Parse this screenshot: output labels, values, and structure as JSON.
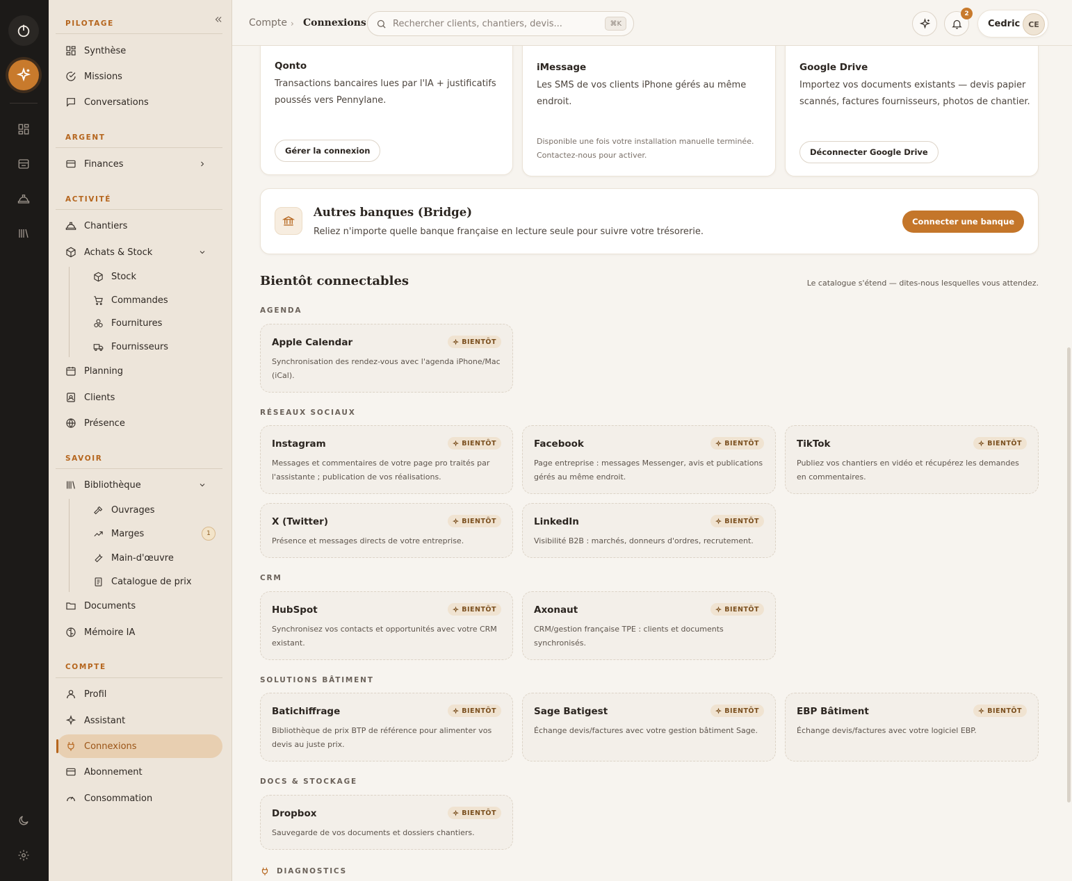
{
  "sidebar": {
    "sections": {
      "pilotage": "PILOTAGE",
      "argent": "ARGENT",
      "activite": "ACTIVITÉ",
      "savoir": "SAVOIR",
      "compte": "COMPTE"
    },
    "items": {
      "synthese": "Synthèse",
      "missions": "Missions",
      "conversations": "Conversations",
      "finances": "Finances",
      "chantiers": "Chantiers",
      "achats_stock": "Achats & Stock",
      "stock": "Stock",
      "commandes": "Commandes",
      "fournitures": "Fournitures",
      "fournisseurs": "Fournisseurs",
      "planning": "Planning",
      "clients": "Clients",
      "presence": "Présence",
      "bibliotheque": "Bibliothèque",
      "ouvrages": "Ouvrages",
      "marges": "Marges",
      "marges_count": "1",
      "main_oeuvre": "Main-d'œuvre",
      "catalogue_prix": "Catalogue de prix",
      "documents": "Documents",
      "memoire_ia": "Mémoire IA",
      "profil": "Profil",
      "assistant": "Assistant",
      "connexions": "Connexions",
      "abonnement": "Abonnement",
      "consommation": "Consommation"
    }
  },
  "topbar": {
    "breadcrumb_root": "Compte",
    "breadcrumb_current": "Connexions",
    "search_placeholder": "Rechercher clients, chantiers, devis...",
    "search_shortcut": "⌘K",
    "notifications_count": "2",
    "user_name": "Cedric",
    "user_initials": "CE"
  },
  "connected": {
    "qonto": {
      "title": "Qonto",
      "desc": "Transactions bancaires lues par l'IA + justificatifs poussés vers Pennylane.",
      "action": "Gérer la connexion"
    },
    "imessage": {
      "title": "iMessage",
      "desc": "Les SMS de vos clients iPhone gérés au même endroit.",
      "note": "Disponible une fois votre installation manuelle terminée. Contactez-nous pour activer."
    },
    "gdrive": {
      "title": "Google Drive",
      "desc": "Importez vos documents existants — devis papier scannés, factures fournisseurs, photos de chantier.",
      "action": "Déconnecter Google Drive"
    }
  },
  "bridge": {
    "title": "Autres banques (Bridge)",
    "desc": "Reliez n'importe quelle banque française en lecture seule pour suivre votre trésorerie.",
    "action": "Connecter une banque"
  },
  "upcoming": {
    "title": "Bientôt connectables",
    "note": "Le catalogue s'étend — dites-nous lesquelles vous attendez.",
    "badge": "BIENTÔT",
    "categories": {
      "agenda": "AGENDA",
      "social": "RÉSEAUX SOCIAUX",
      "crm": "CRM",
      "batiment": "SOLUTIONS BÂTIMENT",
      "docs": "DOCS & STOCKAGE",
      "diagnostics": "DIAGNOSTICS"
    },
    "items": {
      "apple_calendar": {
        "title": "Apple Calendar",
        "desc": "Synchronisation des rendez-vous avec l'agenda iPhone/Mac (iCal)."
      },
      "instagram": {
        "title": "Instagram",
        "desc": "Messages et commentaires de votre page pro traités par l'assistante ; publication de vos réalisations."
      },
      "facebook": {
        "title": "Facebook",
        "desc": "Page entreprise : messages Messenger, avis et publications gérés au même endroit."
      },
      "tiktok": {
        "title": "TikTok",
        "desc": "Publiez vos chantiers en vidéo et récupérez les demandes en commentaires."
      },
      "x_twitter": {
        "title": "X (Twitter)",
        "desc": "Présence et messages directs de votre entreprise."
      },
      "linkedin": {
        "title": "LinkedIn",
        "desc": "Visibilité B2B : marchés, donneurs d'ordres, recrutement."
      },
      "hubspot": {
        "title": "HubSpot",
        "desc": "Synchronisez vos contacts et opportunités avec votre CRM existant."
      },
      "axonaut": {
        "title": "Axonaut",
        "desc": "CRM/gestion française TPE : clients et documents synchronisés."
      },
      "batichiffrage": {
        "title": "Batichiffrage",
        "desc": "Bibliothèque de prix BTP de référence pour alimenter vos devis au juste prix."
      },
      "sage_batigest": {
        "title": "Sage Batigest",
        "desc": "Échange devis/factures avec votre gestion bâtiment Sage."
      },
      "ebp_batiment": {
        "title": "EBP Bâtiment",
        "desc": "Échange devis/factures avec votre logiciel EBP."
      },
      "dropbox": {
        "title": "Dropbox",
        "desc": "Sauvegarde de vos documents et dossiers chantiers."
      }
    }
  },
  "colors": {
    "accent": "#c4762a",
    "sidebar_bg": "#ede5da",
    "rail_bg": "#1c1a18"
  }
}
